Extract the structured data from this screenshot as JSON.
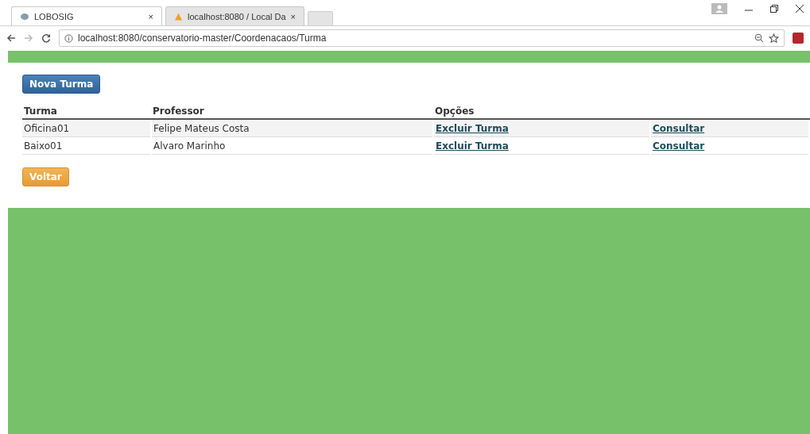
{
  "browser": {
    "tabs": [
      {
        "title": "LOBOSIG",
        "close": "×",
        "selected": true
      },
      {
        "title": "localhost:8080 / Local Da",
        "close": "×",
        "selected": false
      }
    ],
    "url": "localhost:8080/conservatorio-master/Coordenacaos/Turma"
  },
  "page": {
    "new_button": "Nova Turma",
    "table": {
      "columns": [
        "Turma",
        "Professor",
        "Opções"
      ],
      "rows": [
        {
          "turma": "Oficina01",
          "professor": "Felipe Mateus Costa",
          "delete_link": "Excluir Turma",
          "view_link": "Consultar"
        },
        {
          "turma": "Baixo01",
          "professor": "Alvaro Marinho",
          "delete_link": "Excluir Turma",
          "view_link": "Consultar"
        }
      ]
    },
    "back_button": "Voltar"
  }
}
